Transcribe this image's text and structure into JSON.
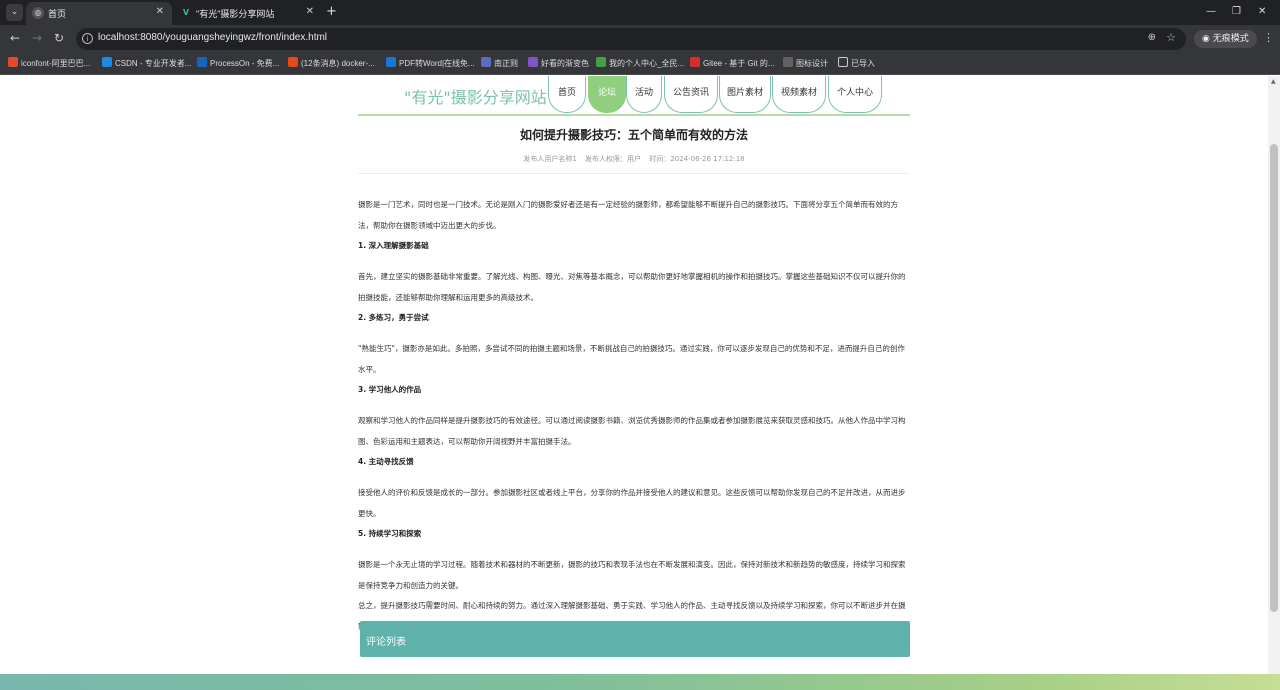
{
  "browser": {
    "tabs": [
      {
        "title": "首页",
        "active": true
      },
      {
        "title": "\"有光\"摄影分享网站",
        "active": false
      }
    ],
    "url": "localhost:8080/youguangsheyingwz/front/index.html",
    "incognito_label": "无痕模式",
    "bookmarks": [
      {
        "label": "iconfont-阿里巴巴...",
        "color": "#e04b2d"
      },
      {
        "label": "CSDN - 专业开发者...",
        "color": "#1e88e5"
      },
      {
        "label": "ProcessOn - 免费...",
        "color": "#1565c0"
      },
      {
        "label": "(12条消息) docker-...",
        "color": "#e64a19"
      },
      {
        "label": "PDF转Word|在线免...",
        "color": "#1976d2"
      },
      {
        "label": "南正则",
        "color": "#5c6bc0"
      },
      {
        "label": "好看的渐变色",
        "color": "#7e57c2"
      },
      {
        "label": "我的个人中心_全民...",
        "color": "#43a047"
      },
      {
        "label": "Gitee - 基于 Git 的...",
        "color": "#d32f2f"
      },
      {
        "label": "图标设计",
        "color": "#616161"
      },
      {
        "label": "已导入",
        "color": "#757575"
      }
    ]
  },
  "site": {
    "title": "\"有光\"摄影分享网站",
    "nav": [
      {
        "label": "首页",
        "active": false
      },
      {
        "label": "论坛",
        "active": true
      },
      {
        "label": "活动",
        "active": false
      },
      {
        "label": "公告资讯",
        "active": false
      },
      {
        "label": "图片素材",
        "active": false
      },
      {
        "label": "视频素材",
        "active": false
      },
      {
        "label": "个人中心",
        "active": false
      }
    ]
  },
  "post": {
    "title": "如何提升摄影技巧：五个简单而有效的方法",
    "meta": {
      "author_name": "发布人用户名称1",
      "author_role": "发布人权限：用户",
      "time": "时间：2024-06-26 17:12:18"
    },
    "paragraphs": [
      {
        "type": "text",
        "text": "摄影是一门艺术，同时也是一门技术。无论是刚入门的摄影爱好者还是有一定经验的摄影师，都希望能够不断提升自己的摄影技巧。下面将分享五个简单而有效的方法，帮助你在摄影领域中迈出更大的步伐。"
      },
      {
        "type": "heading",
        "text": "1. 深入理解摄影基础"
      },
      {
        "type": "text",
        "text": "首先，建立坚实的摄影基础非常重要。了解光线、构图、曝光、对焦等基本概念，可以帮助你更好地掌握相机的操作和拍摄技巧。掌握这些基础知识不仅可以提升你的拍摄技能，还能够帮助你理解和运用更多的高级技术。"
      },
      {
        "type": "heading",
        "text": "2. 多练习，勇于尝试"
      },
      {
        "type": "text",
        "text": "\"熟能生巧\"，摄影亦是如此。多拍照，多尝试不同的拍摄主题和场景，不断挑战自己的拍摄技巧。通过实践，你可以逐步发现自己的优势和不足，进而提升自己的创作水平。"
      },
      {
        "type": "heading",
        "text": "3. 学习他人的作品"
      },
      {
        "type": "text",
        "text": "观察和学习他人的作品同样是提升摄影技巧的有效途径。可以通过阅读摄影书籍、浏览优秀摄影师的作品集或者参加摄影展览来获取灵感和技巧。从他人作品中学习构图、色彩运用和主题表达，可以帮助你开阔视野并丰富拍摄手法。"
      },
      {
        "type": "heading",
        "text": "4. 主动寻找反馈"
      },
      {
        "type": "text",
        "text": "接受他人的评价和反馈是成长的一部分。参加摄影社区或者线上平台，分享你的作品并接受他人的建议和意见。这些反馈可以帮助你发现自己的不足并改进，从而进步更快。"
      },
      {
        "type": "heading",
        "text": "5. 持续学习和探索"
      },
      {
        "type": "text",
        "text": "摄影是一个永无止境的学习过程。随着技术和器材的不断更新，摄影的技巧和表现手法也在不断发展和演变。因此，保持对新技术和新趋势的敏感度，持续学习和探索是保持竞争力和创造力的关键。"
      },
      {
        "type": "text",
        "text": "总之，提升摄影技巧需要时间、耐心和持续的努力。通过深入理解摄影基础、勇于实践、学习他人的作品、主动寻找反馈以及持续学习和探索，你可以不断进步并在摄影领域中找到自己的独特之处。愿这些方法能够帮助你在摄影之路上走得更远，拍出更加出色的作品！"
      }
    ]
  },
  "comments": {
    "title": "评论列表"
  }
}
